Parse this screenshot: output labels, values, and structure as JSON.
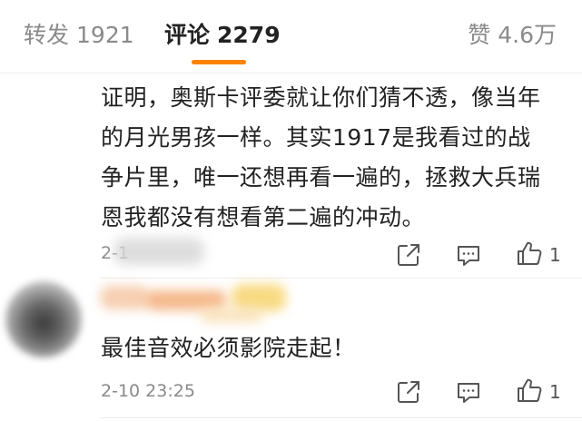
{
  "tabs": {
    "repost": {
      "label": "转发",
      "count": "1921"
    },
    "comments": {
      "label": "评论",
      "count": "2279"
    },
    "likes": {
      "label": "赞",
      "count": "4.6万"
    }
  },
  "colors": {
    "accent": "#ff8200",
    "text_primary": "#222222",
    "text_secondary": "#8a8a8a"
  },
  "comments": [
    {
      "text_lines": [
        "证明，奥斯卡评委就让你们猜不透，像当年",
        "的月光男孩一样。其实1917是我看过的战",
        "争片里，唯一还想再看一遍的，拯救大兵瑞",
        "恩我都没有想看第二遍的冲动。"
      ],
      "time": "2-1",
      "like_count": "1",
      "icons": [
        "share-icon",
        "reply-icon",
        "thumbs-up-icon"
      ]
    },
    {
      "text_lines": [
        "最佳音效必须影院走起！"
      ],
      "time": "2-10 23:25",
      "like_count": "1",
      "icons": [
        "share-icon",
        "reply-icon",
        "thumbs-up-icon"
      ]
    }
  ]
}
